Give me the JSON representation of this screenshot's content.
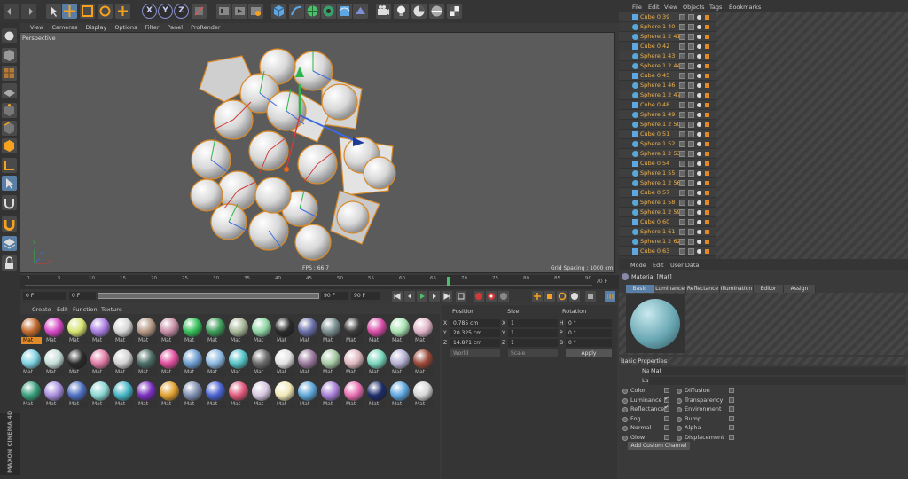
{
  "viewport_menu": [
    "View",
    "Cameras",
    "Display",
    "Options",
    "Filter",
    "Panel",
    "ProRender"
  ],
  "viewport_label": "Perspective",
  "fps": "FPS : 66.7",
  "grid_spacing": "Grid Spacing : 1000 cm",
  "axis_letters": [
    "X",
    "Y",
    "Z"
  ],
  "objects_menu": [
    "File",
    "Edit",
    "View",
    "Objects",
    "Tags",
    "Bookmarks"
  ],
  "objects": [
    "Cube 0 39",
    "Sphere 1 40",
    "Sphere.1 2 41",
    "Cube 0 42",
    "Sphere 1 43",
    "Sphere.1 2 44",
    "Cube 0 45",
    "Sphere 1 46",
    "Sphere.1 2 47",
    "Cube 0 48",
    "Sphere 1 49",
    "Sphere.1 2 50",
    "Cube 0 51",
    "Sphere 1 52",
    "Sphere.1 2 53",
    "Cube 0 54",
    "Sphere 1 55",
    "Sphere.1 2 56",
    "Cube 0 57",
    "Sphere 1 58",
    "Sphere.1 2 59",
    "Cube 0 60",
    "Sphere 1 61",
    "Sphere.1 2 62",
    "Cube 0 63"
  ],
  "timeline_ticks": [
    "0",
    "5",
    "10",
    "15",
    "20",
    "25",
    "30",
    "35",
    "40",
    "45",
    "50",
    "55",
    "60",
    "65",
    "70",
    "75",
    "80",
    "85",
    "90"
  ],
  "timeline_end": "70 F",
  "frame_start": "0 F",
  "frame_mid": "0 F",
  "frame_end": "90 F",
  "frame_end2": "90 F",
  "material_menu": [
    "Create",
    "Edit",
    "Function",
    "Texture"
  ],
  "mat_label": "Mat",
  "mat_colors": [
    [
      "#c46b2e",
      "#d74ac7",
      "#d7e36f",
      "#a97ee0",
      "#d7d7d7",
      "#b39884",
      "#c78ea6",
      "#37c05a",
      "#3e9c5a",
      "#a8b89a",
      "#8fd6a5",
      "#2a2a2a",
      "#6a6fa8",
      "#7b8f90",
      "#3a3a3a",
      "#d84ea8",
      "#a9e2b2",
      "#e1b6c9"
    ],
    [
      "#7fd3e2",
      "#c6ded8",
      "#2b2b2b",
      "#e07ba5",
      "#d3d3d3",
      "#4d6d66",
      "#e04f9e",
      "#6e9ed0",
      "#8cb8e0",
      "#55c2c7",
      "#6c6c6c",
      "#e3e3e3",
      "#9b7a9e",
      "#a7c9a4",
      "#e0b8c0",
      "#7ad6bd",
      "#b6b0d3",
      "#9c4a3a"
    ],
    [
      "#3aa07c",
      "#a98fe0",
      "#4e6fc2",
      "#8ad7d1",
      "#46b6c6",
      "#7b2fbf",
      "#e0a030",
      "#7f8fb0",
      "#4a62d0",
      "#e0597b",
      "#d6c7e0",
      "#f2e9b8",
      "#5fa7d8",
      "#a780d6",
      "#e86fb2",
      "#1e2d6a",
      "#5fa7e0",
      "#d7d7d7"
    ]
  ],
  "coord_headers": [
    "Position",
    "Size",
    "Rotation"
  ],
  "coords": {
    "px": "X",
    "py": "Y",
    "pz": "Z",
    "x": "0.785 cm",
    "y": "20.325 cm",
    "z": "14.871 cm",
    "sx": "X",
    "sy": "Y",
    "sz": "Z",
    "sxv": "1",
    "syv": "1",
    "szv": "1",
    "rh": "H",
    "rp": "P",
    "rb": "B",
    "rhv": "0 °",
    "rpv": "0 °",
    "rbv": "0 °"
  },
  "coord_mode": "World",
  "size_mode": "Scale",
  "apply": "Apply",
  "attr_menu": [
    "Mode",
    "Edit",
    "User Data"
  ],
  "attr_title": "Material [Mat]",
  "attr_tabs": [
    "Basic",
    "Luminance",
    "Reflectance",
    "Illumination",
    "Editor",
    "Assign"
  ],
  "basic_props": "Basic Properties",
  "name_label": "Name",
  "name_value": "Mat",
  "layer_label": "Layer",
  "channels_left": [
    "Color",
    "Luminance",
    "Reflectance",
    "Fog",
    "Normal",
    "Glow"
  ],
  "channels_right": [
    "Diffusion",
    "Transparency",
    "Environment",
    "Bump",
    "Alpha",
    "Displacement"
  ],
  "add_channel": "Add Custom Channel",
  "brand": "MAXON CINEMA 4D",
  "toolbar_xyz": [
    "X",
    "Y",
    "Z"
  ]
}
